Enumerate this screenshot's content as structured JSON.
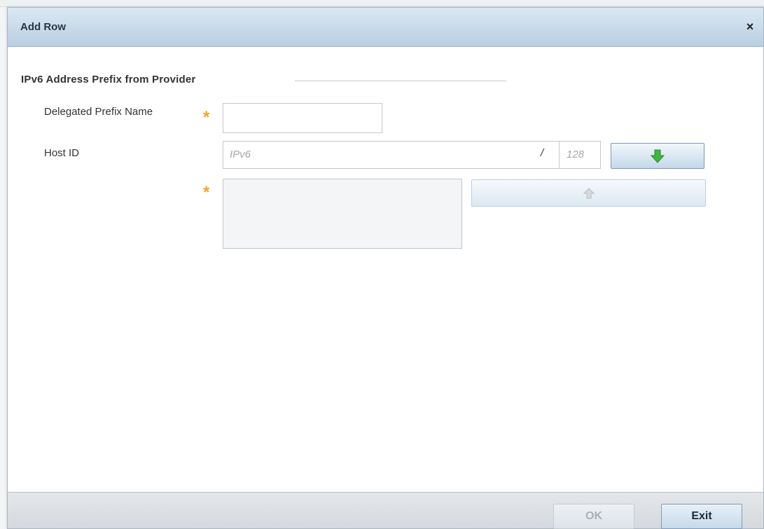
{
  "dialog": {
    "title": "Add Row",
    "close_symbol": "×"
  },
  "section": {
    "title": "IPv6 Address Prefix from Provider"
  },
  "fields": {
    "delegated_prefix_name": {
      "label": "Delegated Prefix Name",
      "value": "",
      "required": true
    },
    "host_id": {
      "label": "Host ID",
      "placeholder": "IPv6",
      "separator": "/",
      "prefix_placeholder": "128"
    },
    "host_id_list": {
      "required": true,
      "items": []
    }
  },
  "buttons": {
    "add_icon": "green-arrow-down-icon",
    "remove_icon": "gray-arrow-up-icon",
    "ok_label": "OK",
    "exit_label": "Exit"
  },
  "colors": {
    "required_star": "#f5a623",
    "add_arrow": "#3db83d",
    "remove_arrow": "#c8ccd0",
    "titlebar": "#c8dcec"
  },
  "required_symbol": "*"
}
